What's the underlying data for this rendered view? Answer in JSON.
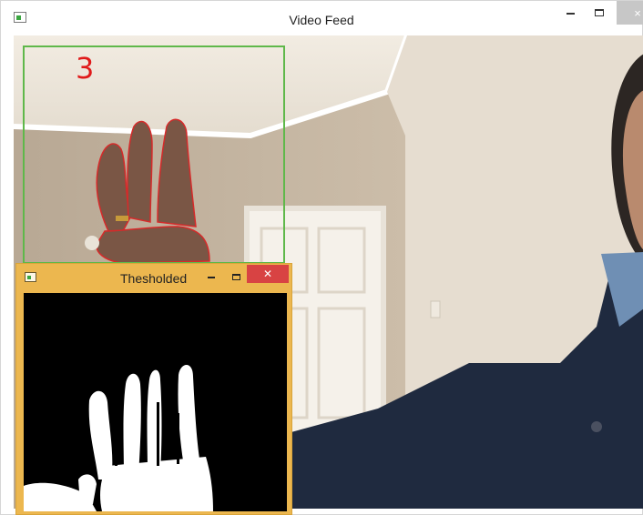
{
  "main_window": {
    "title": "Video Feed",
    "icon": "app-window-icon",
    "close_glyph": "×"
  },
  "overlay": {
    "finger_count": "3",
    "count_color": "#e01a1a",
    "roi_color": "#5fb84a"
  },
  "threshold_window": {
    "title": "Thesholded",
    "icon": "app-window-icon",
    "close_glyph": "✕",
    "frame_color": "#ecb74f"
  }
}
